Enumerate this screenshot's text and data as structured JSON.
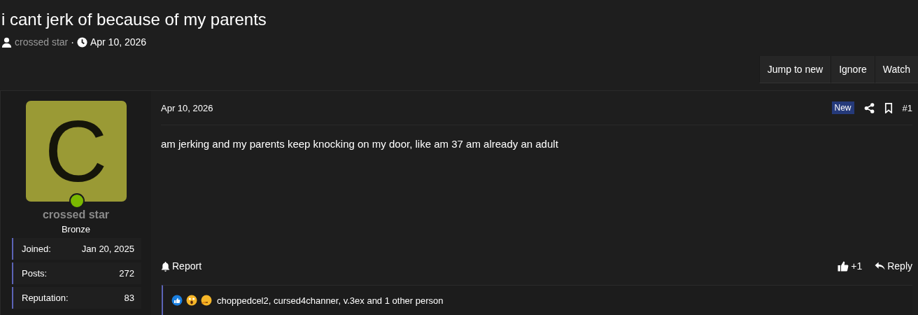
{
  "thread": {
    "title": "i cant jerk of because of my parents",
    "author": "crossed star",
    "separator": "·",
    "date": "Apr 10, 2026"
  },
  "actions": [
    {
      "label": "Jump to new"
    },
    {
      "label": "Ignore"
    },
    {
      "label": "Watch"
    }
  ],
  "user": {
    "avatar_letter": "C",
    "online": true,
    "name": "crossed star",
    "rank": "Bronze",
    "stats": [
      {
        "label": "Joined:",
        "value": "Jan 20, 2025"
      },
      {
        "label": "Posts:",
        "value": "272"
      },
      {
        "label": "Reputation:",
        "value": "83"
      }
    ]
  },
  "post": {
    "date": "Apr 10, 2026",
    "badge": "New",
    "number": "#1",
    "body": "am jerking and my parents keep knocking on my door, like am 37 am already an adult",
    "report": "Report",
    "like": "+1",
    "reply": "Reply",
    "reactions": {
      "icons": [
        {
          "kind": "like"
        },
        {
          "kind": "wow"
        },
        {
          "kind": "thinking"
        }
      ],
      "text": "choppedcel2, cursed4channer, v.3ex and 1 other person"
    }
  }
}
